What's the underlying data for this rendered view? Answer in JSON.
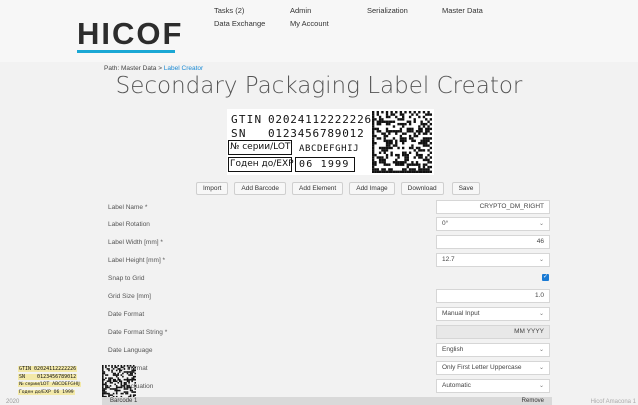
{
  "header": {
    "logo": "HICOF",
    "nav": {
      "tasks": "Tasks (2)",
      "data_exchange": "Data Exchange",
      "admin": "Admin",
      "my_account": "My Account",
      "serialization": "Serialization",
      "master_data": "Master Data"
    }
  },
  "breadcrumb": {
    "prefix": "Path: Master Data > ",
    "current": "Label Creator"
  },
  "page_title": "Secondary Packaging Label Creator",
  "label_preview": {
    "gtin_key": "GTIN",
    "gtin_val": "02024112222226",
    "sn_key": "SN",
    "sn_val": "0123456789012",
    "lot_key": "№ серии/LOT",
    "lot_val": "ABCDEFGHIJ",
    "exp_key": "Годен до/EXP",
    "exp_val": "06 1999"
  },
  "toolbar": {
    "import": "Import",
    "add_barcode": "Add Barcode",
    "add_element": "Add Element",
    "add_image": "Add Image",
    "download": "Download",
    "save": "Save"
  },
  "form": {
    "label_name": {
      "label": "Label Name *",
      "value": "CRYPTO_DM_RIGHT"
    },
    "label_rotation": {
      "label": "Label Rotation",
      "value": "0°"
    },
    "label_width": {
      "label": "Label Width [mm] *",
      "value": "46"
    },
    "label_height": {
      "label": "Label Height [mm] *",
      "value": "12.7"
    },
    "snap_to_grid": {
      "label": "Snap to Grid",
      "checked": true
    },
    "grid_size": {
      "label": "Grid Size [mm]",
      "value": "1.0"
    },
    "date_format": {
      "label": "Date Format",
      "value": "Manual Input"
    },
    "date_format_string": {
      "label": "Date Format String *",
      "value": "MM YYYY"
    },
    "date_language": {
      "label": "Date Language",
      "value": "English"
    },
    "month_format": {
      "label": "Month Format",
      "visible_label": "...t Format",
      "value": "Only First Letter Uppercase"
    },
    "punctuation": {
      "label": "...unctuation",
      "value": "Automatic"
    }
  },
  "bottom": {
    "barcode": "Barcode 1",
    "remove": "Remove"
  },
  "footer": {
    "left": "2020",
    "right": "Hicof Amacona 1"
  },
  "mini_preview": {
    "l1": "GTIN 02024112222226",
    "l2": "SN    0123456789012",
    "l3": "№ серии/LOT  ABCDEFGHIJ",
    "l4": "Годен до/EXP  06  1999"
  },
  "colors": {
    "accent": "#1aa7d4",
    "link": "#1a8ad4",
    "checkbox": "#1a7ad4"
  }
}
